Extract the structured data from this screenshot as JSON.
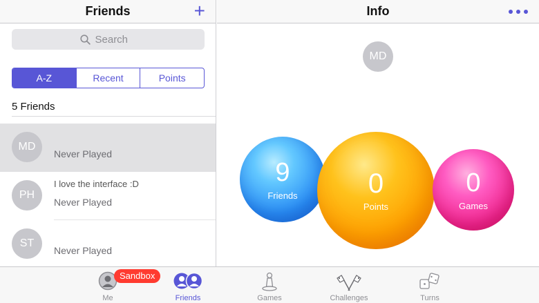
{
  "left_header": {
    "title": "Friends",
    "add_icon": "plus-icon",
    "add_symbol": "+"
  },
  "search": {
    "placeholder": "Search",
    "value": ""
  },
  "segments": [
    {
      "label": "A-Z",
      "active": true
    },
    {
      "label": "Recent",
      "active": false
    },
    {
      "label": "Points",
      "active": false
    }
  ],
  "friend_count": "5 Friends",
  "friends": [
    {
      "initials": "MD",
      "message": "",
      "last_played": "Never Played",
      "selected": true
    },
    {
      "initials": "PH",
      "message": "I love the interface :D",
      "last_played": "Never Played",
      "selected": false
    },
    {
      "initials": "ST",
      "message": "",
      "last_played": "Never Played",
      "selected": false
    }
  ],
  "right_header": {
    "title": "Info",
    "more_icon": "more-dots-icon"
  },
  "info": {
    "initials": "MD",
    "stats": [
      {
        "value": "9",
        "label": "Friends"
      },
      {
        "value": "0",
        "label": "Points"
      },
      {
        "value": "0",
        "label": "Games"
      }
    ]
  },
  "tabs": [
    {
      "label": "Me",
      "icon": "person-icon",
      "active": false
    },
    {
      "label": "Friends",
      "icon": "friends-icon",
      "active": true
    },
    {
      "label": "Games",
      "icon": "game-piece-icon",
      "active": false
    },
    {
      "label": "Challenges",
      "icon": "flags-icon",
      "active": false
    },
    {
      "label": "Turns",
      "icon": "dice-icon",
      "active": false
    }
  ],
  "sandbox_badge": "Sandbox",
  "colors": {
    "accent": "#5856d6",
    "badge": "#ff3b30",
    "avatar": "#c7c7cc",
    "selected_row": "#e1e1e3"
  }
}
